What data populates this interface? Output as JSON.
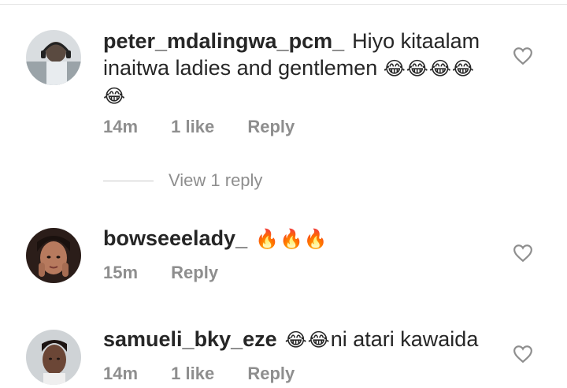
{
  "comments": [
    {
      "username": "peter_mdalingwa_pcm_",
      "text": "Hiyo kitaalam inaitwa ladies and gentlemen",
      "emoji": "😂😂😂😂😂",
      "time": "14m",
      "likes": "1 like",
      "reply": "Reply"
    },
    {
      "username": "bowseeelady_",
      "text": "",
      "emoji": "🔥🔥🔥",
      "time": "15m",
      "likes": "",
      "reply": "Reply"
    },
    {
      "username": "samueli_bky_eze",
      "emoji": "😂😂",
      "text": "ni atari kawaida",
      "time": "14m",
      "likes": "1 like",
      "reply": "Reply"
    }
  ],
  "view_replies_label": "View 1 reply",
  "colors": {
    "text": "#262626",
    "meta": "#8e8e8e",
    "divider": "#c7c7c7"
  }
}
